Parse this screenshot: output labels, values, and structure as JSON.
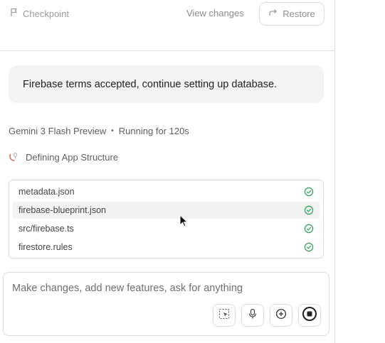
{
  "topbar": {
    "checkpoint_label": "Checkpoint",
    "view_changes_label": "View changes",
    "restore_label": "Restore"
  },
  "user_message": "Firebase terms accepted, continue setting up database.",
  "model_status": {
    "model_name": "Gemini 3 Flash Preview",
    "separator": "•",
    "running": "Running for 120s"
  },
  "current_step": "Defining App Structure",
  "files": [
    {
      "name": "metadata.json",
      "status": "done",
      "hover": false
    },
    {
      "name": "firebase-blueprint.json",
      "status": "done",
      "hover": true
    },
    {
      "name": "src/firebase.ts",
      "status": "done",
      "hover": false
    },
    {
      "name": "firestore.rules",
      "status": "done",
      "hover": false
    }
  ],
  "composer": {
    "placeholder": "Make changes, add new features, ask for anything"
  },
  "colors": {
    "check_green": "#2e9e55",
    "spinner_red": "#e06a5a",
    "bubble_bg": "#f2f3f3"
  }
}
